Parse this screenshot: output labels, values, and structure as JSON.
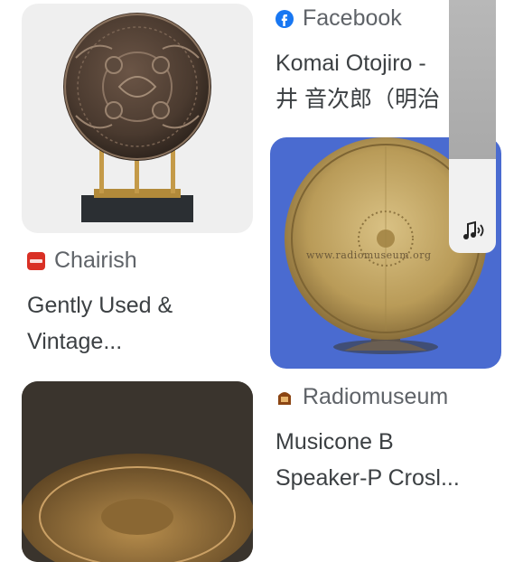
{
  "results": [
    {
      "source": "Chairish",
      "title_lines": [
        "Gently Used &",
        "Vintage..."
      ],
      "source_icon": "chairish-logo-icon",
      "source_icon_text": "Chairish",
      "source_icon_color": "#d93025"
    },
    {
      "source": "Facebook",
      "title_lines": [
        "Komai Otojiro -",
        "井 音次郎（明治"
      ],
      "source_icon": "facebook-icon",
      "source_icon_color": "#1877f2"
    },
    {
      "source": "Radiomuseum",
      "title_lines": [
        "Musicone B",
        "Speaker-P Crosl..."
      ],
      "source_icon": "radiomuseum-icon",
      "source_icon_color": "#8b4513",
      "image_watermark": "www.radiomuseum.org"
    }
  ],
  "overlay": {
    "icon": "music-note-icon"
  },
  "colors": {
    "source_text": "#5f6368",
    "title_text": "#3c4043",
    "card_bg_1": "#f0f0f0",
    "card_bg_2": "#4a6bd0"
  }
}
